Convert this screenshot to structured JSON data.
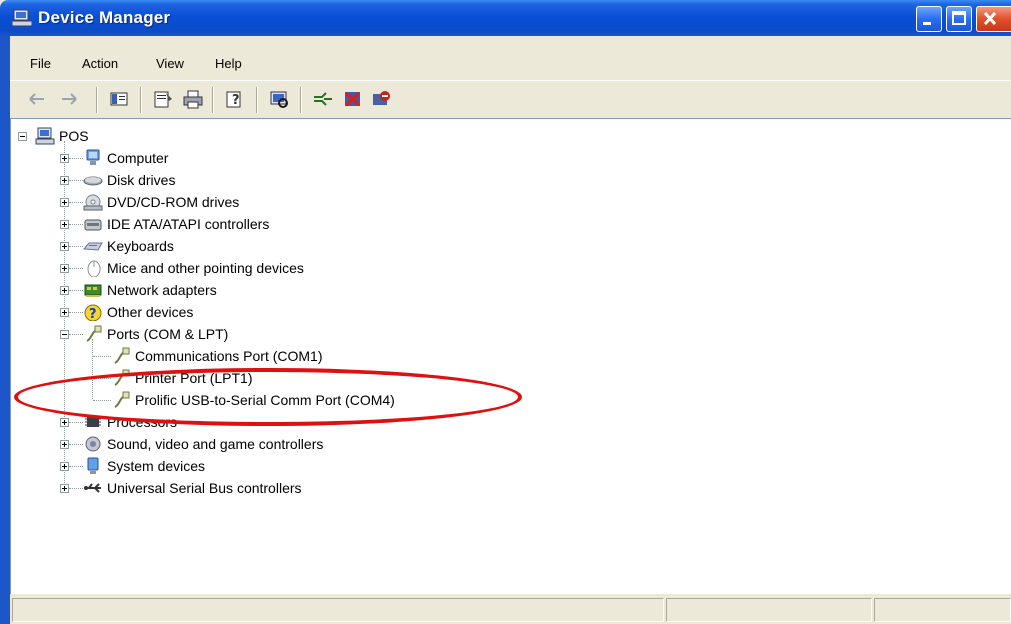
{
  "window": {
    "title": "Device Manager"
  },
  "menu": [
    "File",
    "Action",
    "View",
    "Help"
  ],
  "toolbar": [
    "back-icon",
    "forward-icon",
    "show-hide-console-tree-icon",
    "properties-icon",
    "print-icon",
    "help-icon",
    "scan-hardware-icon",
    "update-driver-icon",
    "uninstall-icon",
    "disable-icon"
  ],
  "tree": {
    "root": "POS",
    "items": [
      {
        "label": "Computer",
        "icon": "computer-icon"
      },
      {
        "label": "Disk drives",
        "icon": "disk-drive-icon"
      },
      {
        "label": "DVD/CD-ROM drives",
        "icon": "cdrom-icon"
      },
      {
        "label": "IDE ATA/ATAPI controllers",
        "icon": "ide-controller-icon"
      },
      {
        "label": "Keyboards",
        "icon": "keyboard-icon"
      },
      {
        "label": "Mice and other pointing devices",
        "icon": "mouse-icon"
      },
      {
        "label": "Network adapters",
        "icon": "network-adapter-icon"
      },
      {
        "label": "Other devices",
        "icon": "unknown-device-icon"
      },
      {
        "label": "Ports (COM & LPT)",
        "icon": "port-icon"
      },
      {
        "label": "Processors",
        "icon": "processor-icon"
      },
      {
        "label": "Sound, video and game controllers",
        "icon": "sound-icon"
      },
      {
        "label": "System devices",
        "icon": "system-device-icon"
      },
      {
        "label": "Universal Serial Bus controllers",
        "icon": "usb-icon"
      }
    ],
    "ports_children": [
      "Communications Port (COM1)",
      "Printer Port (LPT1)",
      "Prolific USB-to-Serial Comm Port (COM4)"
    ]
  },
  "highlight_color": "#e01010"
}
